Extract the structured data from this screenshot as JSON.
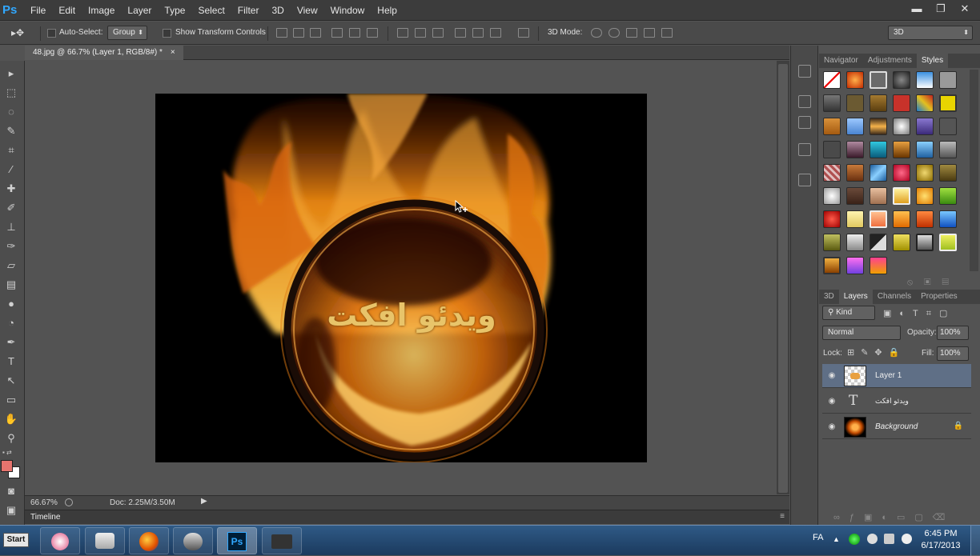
{
  "app": {
    "logo": "Ps"
  },
  "menu": [
    "File",
    "Edit",
    "Image",
    "Layer",
    "Type",
    "Select",
    "Filter",
    "3D",
    "View",
    "Window",
    "Help"
  ],
  "window_controls": {
    "minimize": "▬",
    "restore": "❐",
    "close": "✕"
  },
  "options_bar": {
    "auto_select_label": "Auto-Select:",
    "auto_select_value": "Group",
    "show_transform_label": "Show Transform Controls",
    "mode_3d_label": "3D Mode:",
    "workspace": "3D"
  },
  "document_tab": {
    "title": "48.jpg @ 66.7% (Layer 1, RGB/8#) *",
    "close": "×"
  },
  "canvas_text": "ويدئو افكت",
  "status_bar": {
    "zoom": "66.67%",
    "doc_info": "Doc: 2.25M/3.50M"
  },
  "timeline_label": "Timeline",
  "styles_panel": {
    "tabs": [
      "Navigator",
      "Adjustments",
      "Styles"
    ],
    "active_tab": "Styles"
  },
  "layers_panel": {
    "tabs": [
      "3D",
      "Layers",
      "Channels",
      "Properties"
    ],
    "active_tab": "Layers",
    "filter_kind": "Kind",
    "blend_mode": "Normal",
    "opacity_label": "Opacity:",
    "opacity_value": "100%",
    "lock_label": "Lock:",
    "fill_label": "Fill:",
    "fill_value": "100%",
    "layers": [
      {
        "name": "Layer 1",
        "selected": true
      },
      {
        "name": "ويدئو افكت",
        "type": "text"
      },
      {
        "name": "Background",
        "locked": true
      }
    ]
  },
  "taskbar": {
    "start_label": "Start",
    "language": "FA",
    "time": "6:45 PM",
    "date": "6/17/2013"
  },
  "colors": {
    "foreground": "#e6746e",
    "background": "#ffffff",
    "accent": "#31a8ff"
  }
}
